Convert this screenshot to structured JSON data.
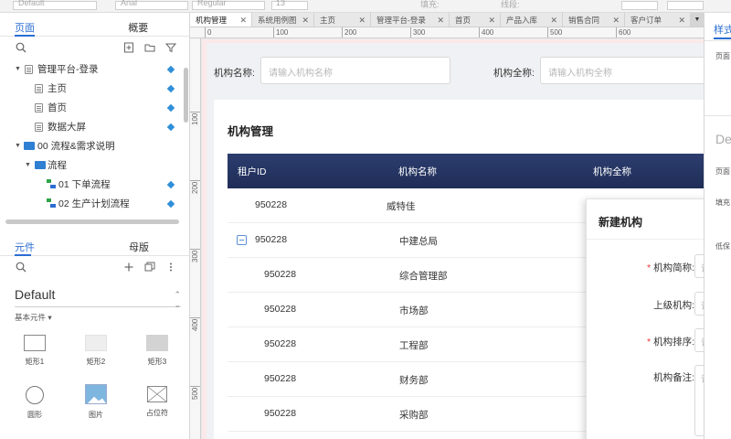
{
  "toolbar": {
    "font_name": "Default",
    "font_family": "Arial",
    "font_weight": "Regular",
    "font_size": "13",
    "fill_label": "填充:",
    "border_label": "线段:"
  },
  "left_panel": {
    "tabs": [
      "页面",
      "概要"
    ],
    "tree": [
      {
        "label": "管理平台-登录",
        "type": "page",
        "level": 0,
        "caret": "▼"
      },
      {
        "label": "主页",
        "type": "page",
        "level": 1
      },
      {
        "label": "首页",
        "type": "page",
        "level": 1
      },
      {
        "label": "数据大屏",
        "type": "page",
        "level": 1
      },
      {
        "label": "00 流程&需求说明",
        "type": "folder",
        "level": 0,
        "caret": "▼"
      },
      {
        "label": "流程",
        "type": "folder",
        "level": 1,
        "caret": "▼"
      },
      {
        "label": "01  下单流程",
        "type": "flow",
        "level": 2
      },
      {
        "label": "02  生产计划流程",
        "type": "flow",
        "level": 2
      }
    ],
    "lib_tabs": [
      "元件",
      "母版"
    ],
    "library": "Default",
    "lib_section": "基本元件 ▾",
    "widgets": [
      "矩形1",
      "矩形2",
      "矩形3",
      "圆形",
      "图片",
      "占位符"
    ]
  },
  "doc_tabs": [
    "机构管理",
    "系统用例图",
    "主页",
    "管理平台-登录",
    "首页",
    "产品入库",
    "销售合同",
    "客户订单"
  ],
  "ruler": {
    "h_ticks": [
      "0",
      "100",
      "200",
      "300",
      "400",
      "500",
      "600"
    ],
    "v_ticks": [
      "100",
      "200",
      "300",
      "400",
      "500"
    ]
  },
  "filters": {
    "name_label": "机构名称:",
    "name_placeholder": "请输入机构名称",
    "full_label": "机构全称:",
    "full_placeholder": "请输入机构全称"
  },
  "card": {
    "title": "机构管理",
    "columns": [
      "租户ID",
      "机构名称",
      "机构全称"
    ],
    "rows": [
      {
        "id": "950228",
        "name": "威特佳"
      },
      {
        "id": "950228",
        "name": "中建总局"
      },
      {
        "id": "950228",
        "name": "综合管理部"
      },
      {
        "id": "950228",
        "name": "市场部"
      },
      {
        "id": "950228",
        "name": "工程部"
      },
      {
        "id": "950228",
        "name": "财务部"
      },
      {
        "id": "950228",
        "name": "采购部"
      }
    ]
  },
  "modal": {
    "title": "新建机构",
    "fields": [
      {
        "label": "机构简称:",
        "required": true,
        "placeholder": "请"
      },
      {
        "label": "上级机构:",
        "required": false,
        "placeholder": "请"
      },
      {
        "label": "机构排序:",
        "required": true,
        "placeholder": "请"
      },
      {
        "label": "机构备注:",
        "required": false,
        "placeholder": "请"
      }
    ]
  },
  "right_panel": {
    "tab": "样式",
    "labels": [
      "页面",
      "De",
      "页面",
      "填充",
      "低保"
    ]
  }
}
